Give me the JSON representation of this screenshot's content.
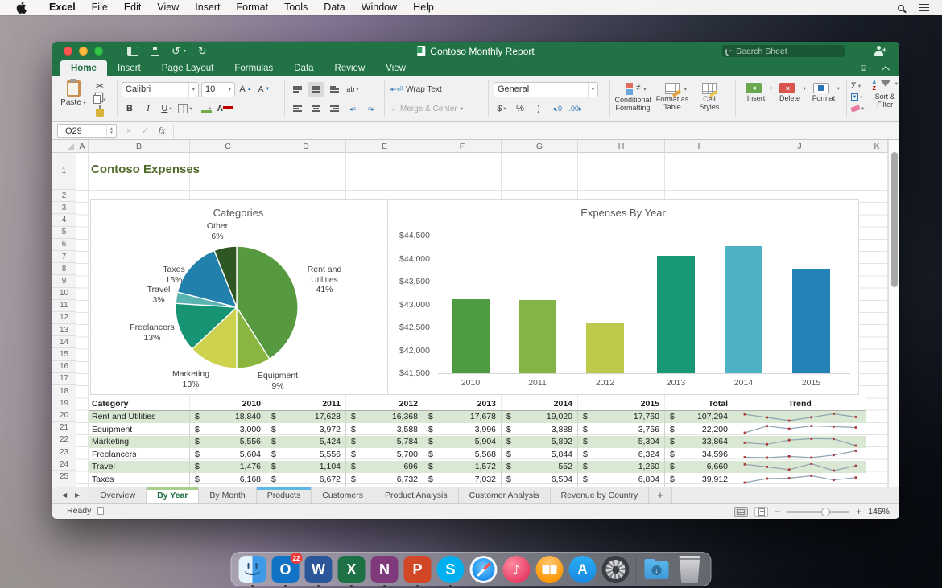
{
  "menu_bar": {
    "items": [
      "Excel",
      "File",
      "Edit",
      "View",
      "Insert",
      "Format",
      "Tools",
      "Data",
      "Window",
      "Help"
    ],
    "right_icons": [
      "spotlight-search",
      "notification-center"
    ]
  },
  "titlebar": {
    "title": "Contoso Monthly Report",
    "search_placeholder": "Search Sheet"
  },
  "ribbon_tabs": {
    "items": [
      "Home",
      "Insert",
      "Page Layout",
      "Formulas",
      "Data",
      "Review",
      "View"
    ],
    "active": "Home"
  },
  "ribbon": {
    "paste_label": "Paste",
    "font_name": "Calibri",
    "font_size": "10",
    "bold": "B",
    "italic": "I",
    "underline": "U",
    "wrap_text_label": "Wrap Text",
    "merge_center_label": "Merge & Center",
    "number_format": "General",
    "currency": "$",
    "percent": "%",
    "comma": ")",
    "increase_decimal": "◂.0",
    "decrease_decimal": ".00▸",
    "conditional_formatting_label": "Conditional Formatting",
    "format_as_table_label": "Format as Table",
    "cell_styles_label": "Cell Styles",
    "insert_label": "Insert",
    "delete_label": "Delete",
    "format_label": "Format",
    "sum_symbol": "Σ",
    "sort_filter_label": "Sort & Filter"
  },
  "formula_bar": {
    "name_box": "O29",
    "fx_label": "fx"
  },
  "sheet": {
    "title_cell": "Contoso Expenses",
    "columns": [
      "A",
      "B",
      "C",
      "D",
      "E",
      "F",
      "G",
      "H",
      "I",
      "J",
      "K"
    ],
    "row_count": 25
  },
  "chart_data": [
    {
      "type": "pie",
      "title": "Categories",
      "slices": [
        {
          "label": "Rent and Utilities",
          "pct": 41,
          "color": "#57993f"
        },
        {
          "label": "Equipment",
          "pct": 9,
          "color": "#8ab63f"
        },
        {
          "label": "Marketing",
          "pct": 13,
          "color": "#ccd24e"
        },
        {
          "label": "Freelancers",
          "pct": 13,
          "color": "#169474"
        },
        {
          "label": "Travel",
          "pct": 3,
          "color": "#5ab4af"
        },
        {
          "label": "Taxes",
          "pct": 15,
          "color": "#2280ad"
        },
        {
          "label": "Other",
          "pct": 6,
          "color": "#2f5723"
        }
      ]
    },
    {
      "type": "bar",
      "title": "Expenses By Year",
      "categories": [
        "2010",
        "2011",
        "2012",
        "2013",
        "2014",
        "2015"
      ],
      "values": [
        43110,
        43095,
        42590,
        44060,
        44270,
        43780
      ],
      "colors": [
        "#4f9b41",
        "#84b447",
        "#bcc94a",
        "#189877",
        "#4db3c4",
        "#2382b6"
      ],
      "ylim": [
        41500,
        44500
      ],
      "ytick_step": 500,
      "ylabel_format": "$#,##0",
      "grid": false,
      "legend": false
    }
  ],
  "table": {
    "currency_symbol": "$",
    "headers": [
      "Category",
      "2010",
      "2011",
      "2012",
      "2013",
      "2014",
      "2015",
      "Total",
      "Trend"
    ],
    "rows": [
      {
        "category": "Rent and Utilities",
        "values": [
          18840,
          17628,
          16368,
          17678,
          19020,
          17760
        ],
        "total": 107294
      },
      {
        "category": "Equipment",
        "values": [
          3000,
          3972,
          3588,
          3996,
          3888,
          3756
        ],
        "total": 22200
      },
      {
        "category": "Marketing",
        "values": [
          5556,
          5424,
          5784,
          5904,
          5892,
          5304
        ],
        "total": 33864
      },
      {
        "category": "Freelancers",
        "values": [
          5604,
          5556,
          5700,
          5568,
          5844,
          6324
        ],
        "total": 34596
      },
      {
        "category": "Travel",
        "values": [
          1476,
          1104,
          696,
          1572,
          552,
          1260
        ],
        "total": 6660
      },
      {
        "category": "Taxes",
        "values": [
          6168,
          6672,
          6732,
          7032,
          6504,
          6804
        ],
        "total": 39912
      }
    ]
  },
  "sheet_tabs": {
    "items": [
      "Overview",
      "By Year",
      "By Month",
      "Products",
      "Customers",
      "Product Analysis",
      "Customer Analysis",
      "Revenue by Country"
    ],
    "active": "By Year",
    "add_label": "+"
  },
  "status_bar": {
    "status": "Ready",
    "zoom": "145%"
  },
  "dock": {
    "apps": [
      "finder",
      "outlook",
      "word",
      "excel",
      "onenote",
      "powerpoint",
      "skype",
      "safari",
      "itunes",
      "ibooks",
      "app-store",
      "system-preferences",
      "downloads",
      "trash"
    ],
    "outlook_badge": "22",
    "running": [
      "finder",
      "outlook",
      "word",
      "excel",
      "onenote",
      "powerpoint",
      "skype"
    ]
  }
}
